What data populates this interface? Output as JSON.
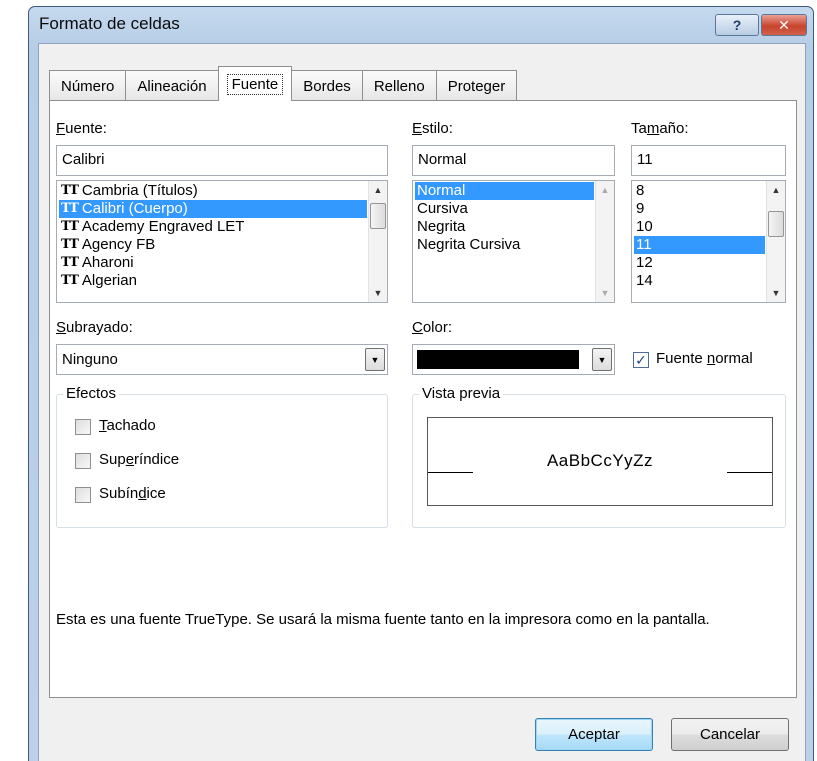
{
  "window": {
    "title": "Formato de celdas",
    "help_label": "?",
    "close_label": "✕"
  },
  "tabs": [
    {
      "label": "Número"
    },
    {
      "label": "Alineación"
    },
    {
      "label": "Fuente"
    },
    {
      "label": "Bordes"
    },
    {
      "label": "Relleno"
    },
    {
      "label": "Proteger"
    }
  ],
  "font": {
    "label_pre": "",
    "label_key": "F",
    "label_post": "uente:",
    "value": "Calibri",
    "items": [
      {
        "label": "Cambria (Títulos)",
        "icon": "truetype-icon",
        "selected": false
      },
      {
        "label": "Calibri (Cuerpo)",
        "icon": "truetype-icon",
        "selected": true
      },
      {
        "label": "Academy Engraved LET",
        "icon": "truetype-icon",
        "selected": false
      },
      {
        "label": "Agency FB",
        "icon": "truetype-icon",
        "selected": false
      },
      {
        "label": "Aharoni",
        "icon": "truetype-icon",
        "selected": false
      },
      {
        "label": "Algerian",
        "icon": "truetype-icon",
        "selected": false
      }
    ]
  },
  "style": {
    "label_pre": "",
    "label_key": "E",
    "label_post": "stilo:",
    "value": "Normal",
    "items": [
      {
        "label": "Normal",
        "selected": true
      },
      {
        "label": "Cursiva",
        "selected": false
      },
      {
        "label": "Negrita",
        "selected": false
      },
      {
        "label": "Negrita Cursiva",
        "selected": false
      }
    ]
  },
  "size": {
    "label_pre": "Ta",
    "label_key": "m",
    "label_post": "año:",
    "value": "11",
    "items": [
      {
        "label": "8",
        "selected": false
      },
      {
        "label": "9",
        "selected": false
      },
      {
        "label": "10",
        "selected": false
      },
      {
        "label": "11",
        "selected": true
      },
      {
        "label": "12",
        "selected": false
      },
      {
        "label": "14",
        "selected": false
      }
    ]
  },
  "underline": {
    "label_pre": "",
    "label_key": "S",
    "label_post": "ubrayado:",
    "value": "Ninguno"
  },
  "color": {
    "label_pre": "",
    "label_key": "C",
    "label_post": "olor:",
    "swatch": "#000000"
  },
  "normal_font": {
    "label_pre": "Fuente ",
    "label_key": "n",
    "label_post": "ormal",
    "checked": true
  },
  "effects": {
    "legend": "Efectos",
    "items": [
      {
        "pre": "",
        "key": "T",
        "post": "achado",
        "checked": false
      },
      {
        "pre": "Sup",
        "key": "e",
        "post": "ríndice",
        "checked": false
      },
      {
        "pre": "Subín",
        "key": "d",
        "post": "ice",
        "checked": false
      }
    ]
  },
  "preview": {
    "legend": "Vista previa",
    "sample": "AaBbCcYyZz"
  },
  "info_text": "Esta es una fuente TrueType. Se usará la misma fuente tanto en la impresora como en la pantalla.",
  "buttons": {
    "ok": "Aceptar",
    "cancel": "Cancelar"
  },
  "colors": {
    "selection": "#3399ff",
    "titlebar": "#bcd1e8",
    "close": "#c8442f"
  }
}
